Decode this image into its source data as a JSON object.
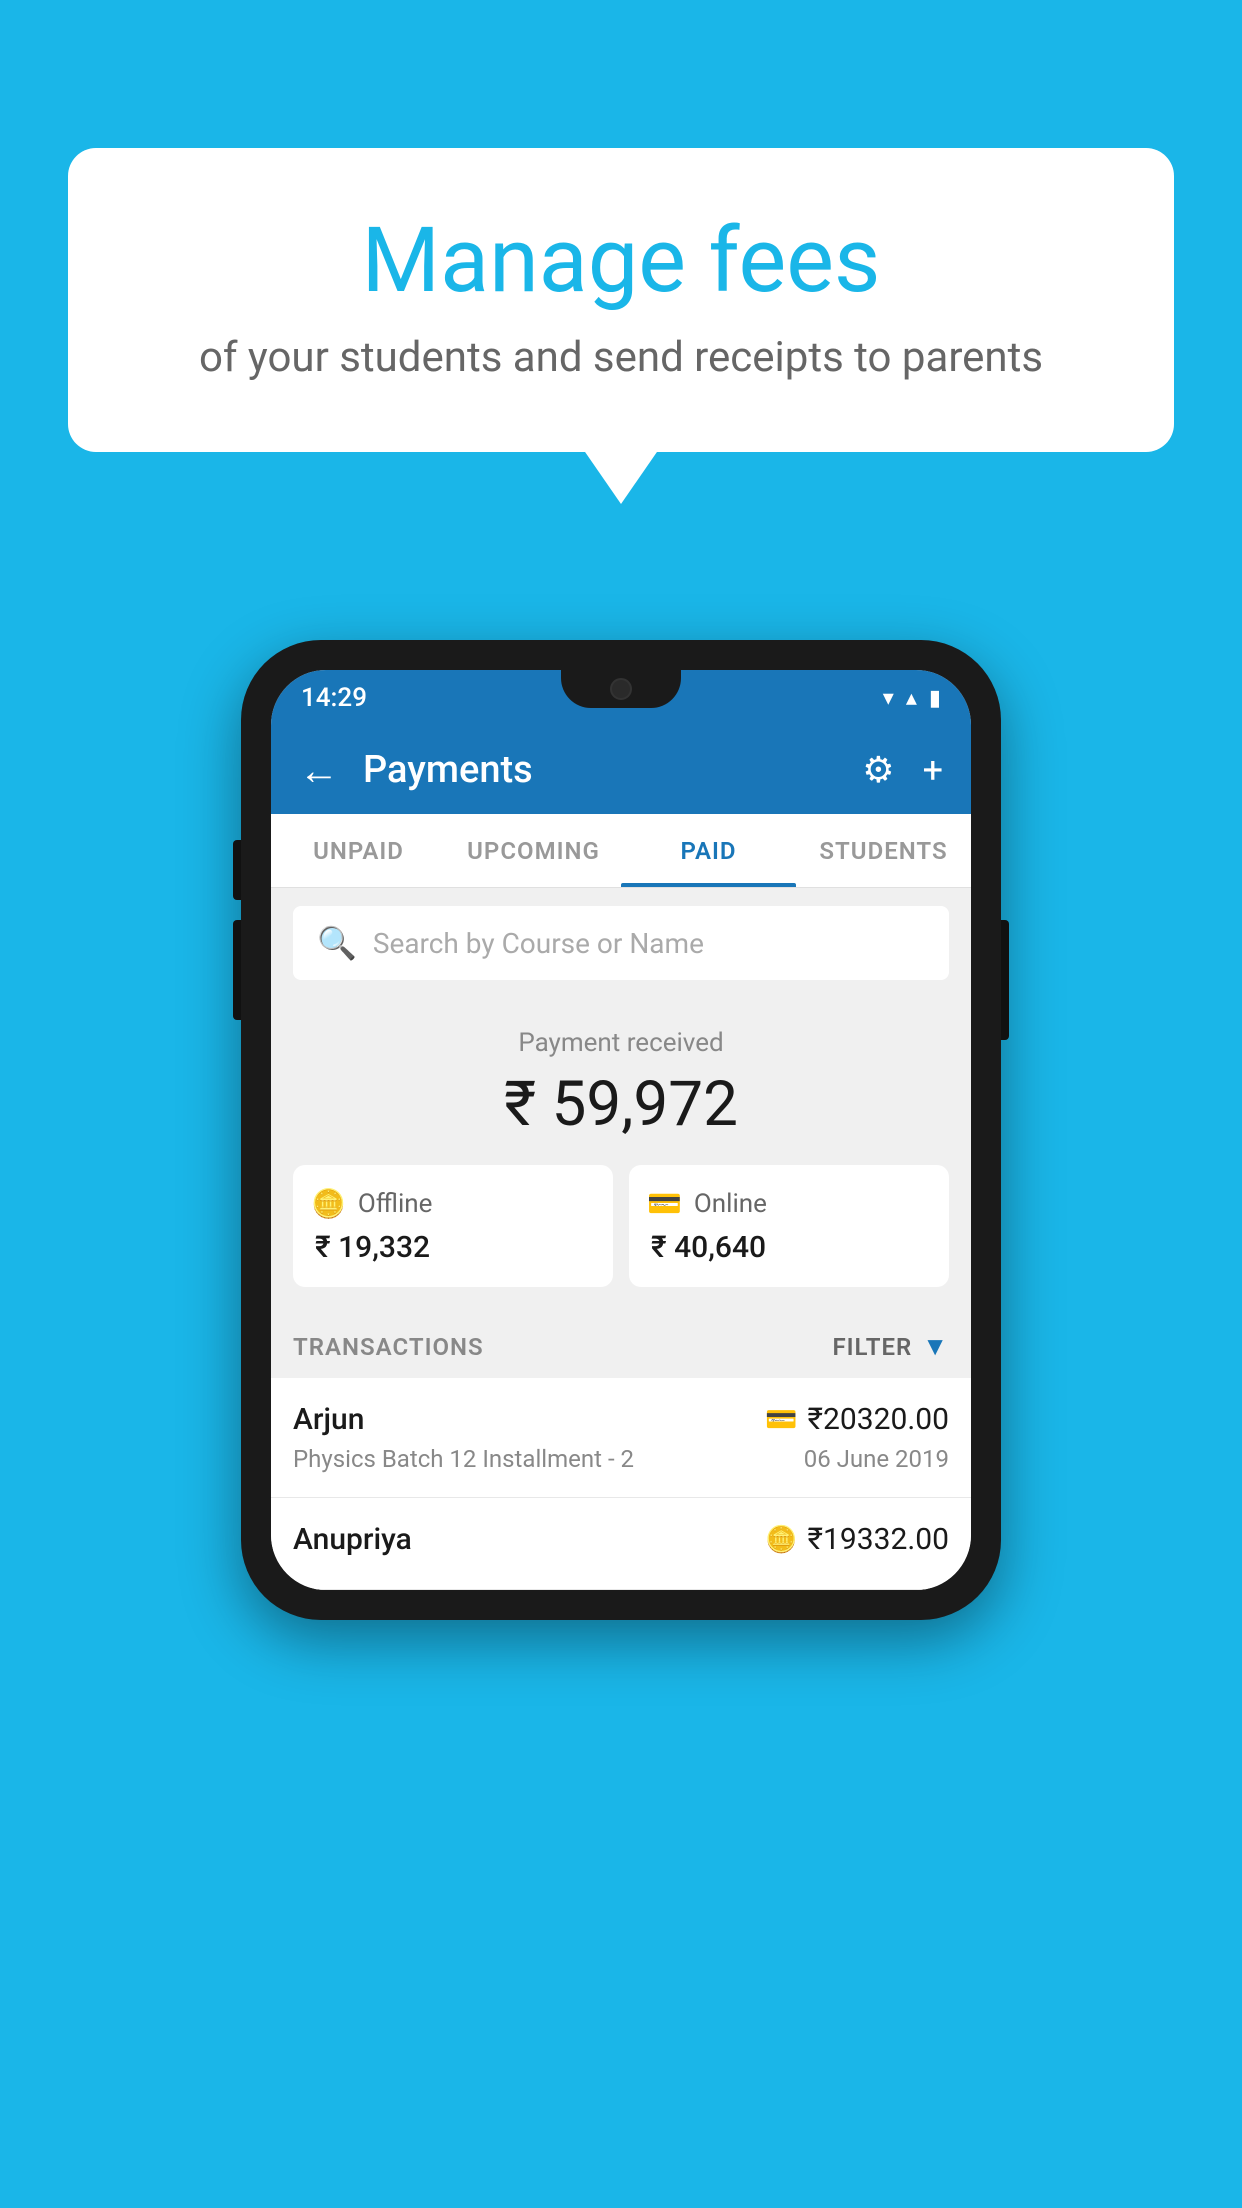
{
  "background_color": "#1ab6e8",
  "speech_bubble": {
    "title": "Manage fees",
    "subtitle": "of your students and send receipts to parents"
  },
  "phone": {
    "status_bar": {
      "time": "14:29",
      "wifi": "▼",
      "signal": "▲",
      "battery": "▌"
    },
    "header": {
      "title": "Payments",
      "back_label": "←",
      "settings_label": "⚙",
      "plus_label": "+"
    },
    "tabs": [
      {
        "label": "UNPAID",
        "active": false
      },
      {
        "label": "UPCOMING",
        "active": false
      },
      {
        "label": "PAID",
        "active": true
      },
      {
        "label": "STUDENTS",
        "active": false
      }
    ],
    "search": {
      "placeholder": "Search by Course or Name"
    },
    "payment_summary": {
      "received_label": "Payment received",
      "total_amount": "₹ 59,972",
      "offline_label": "Offline",
      "offline_amount": "₹ 19,332",
      "online_label": "Online",
      "online_amount": "₹ 40,640"
    },
    "transactions": {
      "section_label": "TRANSACTIONS",
      "filter_label": "FILTER",
      "rows": [
        {
          "name": "Arjun",
          "course": "Physics Batch 12 Installment - 2",
          "amount": "₹20320.00",
          "date": "06 June 2019",
          "payment_type": "online"
        },
        {
          "name": "Anupriya",
          "course": "",
          "amount": "₹19332.00",
          "date": "",
          "payment_type": "offline"
        }
      ]
    }
  }
}
